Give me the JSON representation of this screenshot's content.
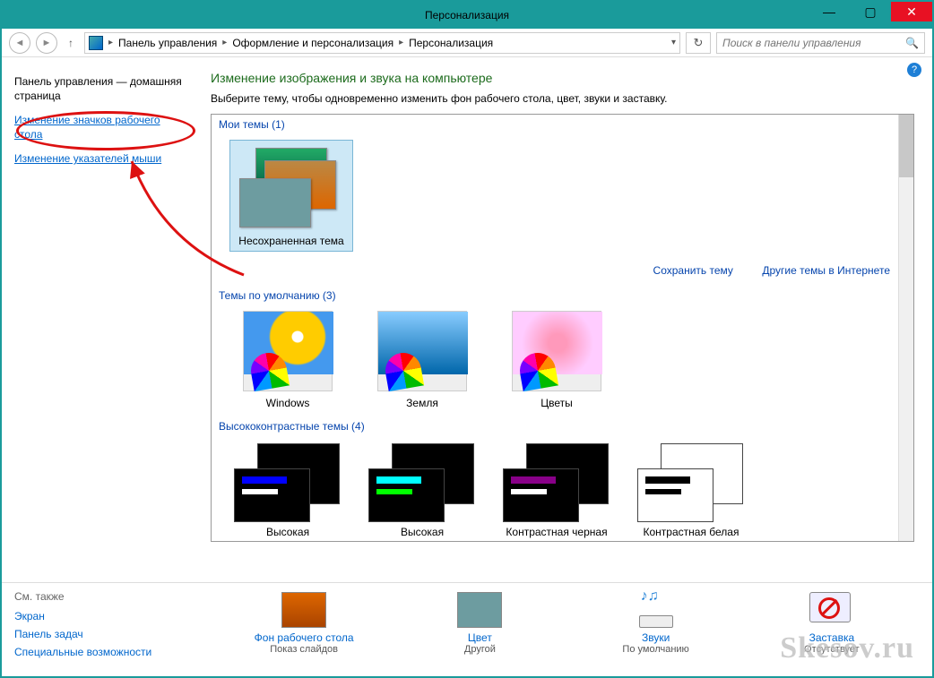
{
  "window": {
    "title": "Персонализация"
  },
  "nav": {
    "breadcrumb": [
      "Панель управления",
      "Оформление и персонализация",
      "Персонализация"
    ],
    "search_placeholder": "Поиск в панели управления"
  },
  "sidebar": {
    "home": "Панель управления — домашняя страница",
    "links": [
      "Изменение значков рабочего стола",
      "Изменение указателей мыши"
    ]
  },
  "main": {
    "heading": "Изменение изображения и звука на компьютере",
    "description": "Выберите тему, чтобы одновременно изменить фон рабочего стола, цвет, звуки и заставку.",
    "sections": {
      "my": {
        "label": "Мои темы (1)",
        "items": [
          "Несохраненная тема"
        ]
      },
      "default": {
        "label": "Темы по умолчанию (3)",
        "items": [
          "Windows",
          "Земля",
          "Цветы"
        ]
      },
      "hc": {
        "label": "Высококонтрастные темы (4)",
        "items": [
          "Высокая",
          "Высокая",
          "Контрастная черная",
          "Контрастная белая"
        ]
      }
    },
    "actions": {
      "save": "Сохранить тему",
      "more": "Другие темы в Интернете"
    }
  },
  "bottom": {
    "see_also_hdr": "См. также",
    "see_also": [
      "Экран",
      "Панель задач",
      "Специальные возможности"
    ],
    "items": [
      {
        "link": "Фон рабочего стола",
        "sub": "Показ слайдов"
      },
      {
        "link": "Цвет",
        "sub": "Другой"
      },
      {
        "link": "Звуки",
        "sub": "По умолчанию"
      },
      {
        "link": "Заставка",
        "sub": "Отсутствует"
      }
    ]
  },
  "watermark": "Skesov.ru"
}
